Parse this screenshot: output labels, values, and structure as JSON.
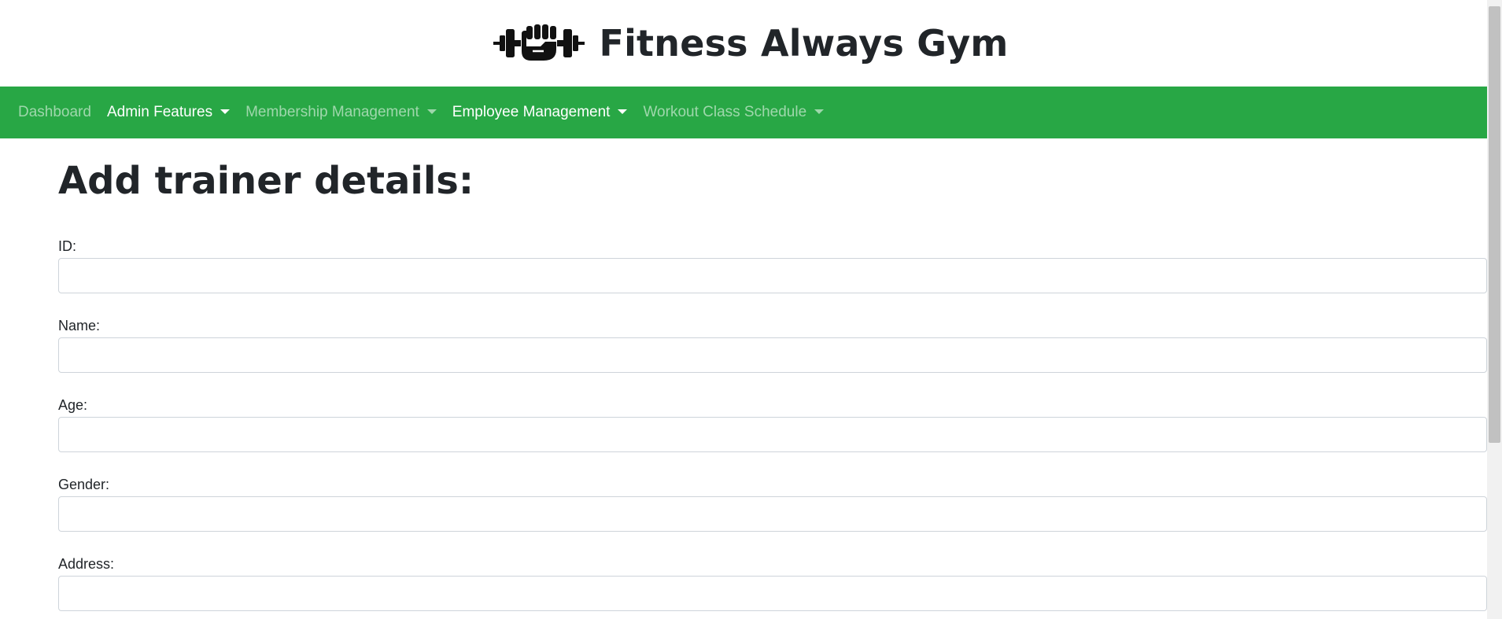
{
  "header": {
    "title": "Fitness Always Gym",
    "logo_icon": "dumbbell-fist-icon"
  },
  "nav": {
    "items": [
      {
        "label": "Dashboard",
        "dropdown": false,
        "state": "muted"
      },
      {
        "label": "Admin Features",
        "dropdown": true,
        "state": "active"
      },
      {
        "label": "Membership Management",
        "dropdown": true,
        "state": "muted"
      },
      {
        "label": "Employee Management",
        "dropdown": true,
        "state": "active"
      },
      {
        "label": "Workout Class Schedule",
        "dropdown": true,
        "state": "muted"
      }
    ]
  },
  "form": {
    "heading": "Add trainer details:",
    "fields": [
      {
        "label": "ID:",
        "value": "",
        "placeholder": ""
      },
      {
        "label": "Name:",
        "value": "",
        "placeholder": ""
      },
      {
        "label": "Age:",
        "value": "",
        "placeholder": ""
      },
      {
        "label": "Gender:",
        "value": "",
        "placeholder": ""
      },
      {
        "label": "Address:",
        "value": "",
        "placeholder": ""
      }
    ]
  },
  "colors": {
    "navbar": "#28a745",
    "nav_active_text": "#ffffff",
    "nav_muted_text": "rgba(255,255,255,0.55)"
  }
}
